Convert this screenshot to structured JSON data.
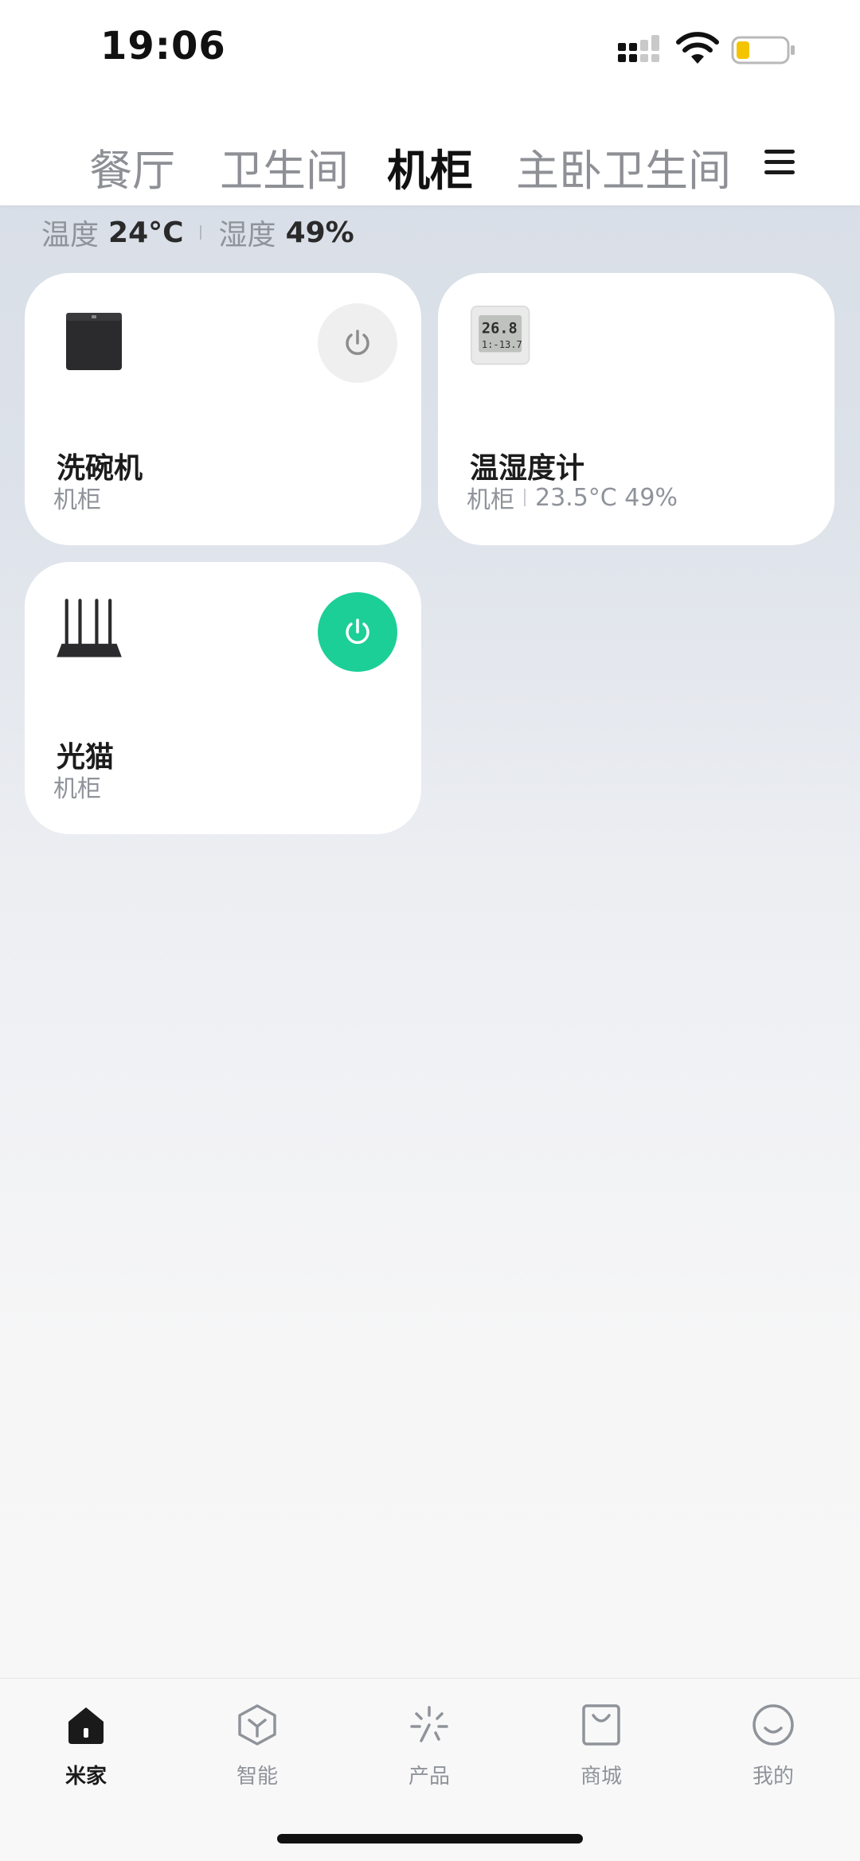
{
  "status_bar": {
    "time": "19:06"
  },
  "room_tabs": {
    "items": [
      {
        "label": "餐厅"
      },
      {
        "label": "卫生间"
      },
      {
        "label": "机柜"
      },
      {
        "label": "主卧卫生间"
      }
    ],
    "active_index": 2,
    "menu_icon": "hamburger-menu-icon"
  },
  "environment": {
    "temperature_label": "温度",
    "temperature_value": "24°C",
    "humidity_label": "湿度",
    "humidity_value": "49%"
  },
  "devices": [
    {
      "name": "洗碗机",
      "room": "机柜",
      "status": "",
      "icon": "dishwasher-icon",
      "power": "off"
    },
    {
      "name": "温湿度计",
      "room": "机柜",
      "status": "23.5°C 49%",
      "icon": "thermo-hygrometer-icon",
      "power": null
    },
    {
      "name": "光猫",
      "room": "机柜",
      "status": "",
      "icon": "router-icon",
      "power": "on"
    }
  ],
  "bottom_nav": {
    "items": [
      {
        "label": "米家",
        "icon": "home-icon"
      },
      {
        "label": "智能",
        "icon": "smart-cube-icon"
      },
      {
        "label": "产品",
        "icon": "product-sparkle-icon"
      },
      {
        "label": "商城",
        "icon": "shopping-bag-icon"
      },
      {
        "label": "我的",
        "icon": "profile-smile-icon"
      }
    ],
    "active_index": 0
  },
  "colors": {
    "power_on": "#1ccf97",
    "power_off_bg": "#efefef",
    "battery_level": "#f5c400"
  }
}
